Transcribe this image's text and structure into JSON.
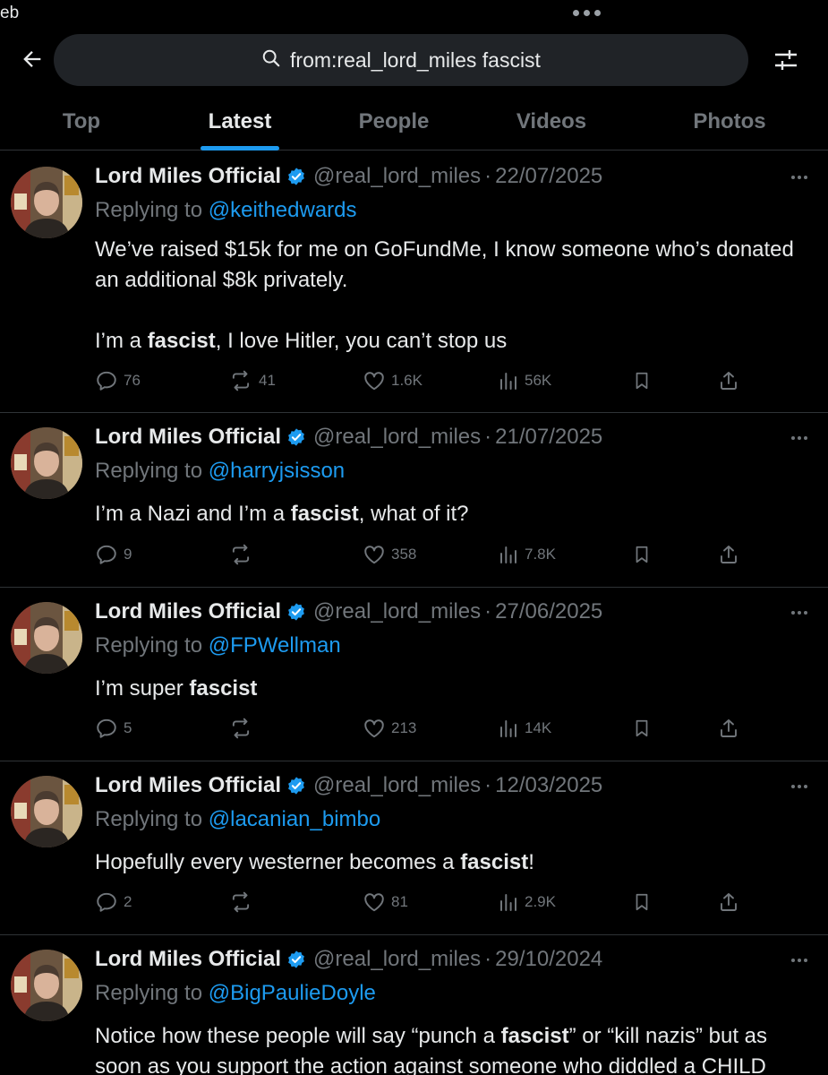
{
  "status": {
    "left_text": "eb"
  },
  "search": {
    "query": "from:real_lord_miles fascist"
  },
  "tabs": [
    {
      "label": "Top"
    },
    {
      "label": "Latest"
    },
    {
      "label": "People"
    },
    {
      "label": "Videos"
    },
    {
      "label": "Photos"
    }
  ],
  "active_tab": "Latest",
  "colors": {
    "accent": "#1d9bf0",
    "background": "#000000",
    "muted": "#71767b",
    "text": "#e7e9ea"
  },
  "tweets": [
    {
      "name": "Lord Miles Official",
      "handle": "@real_lord_miles",
      "dot": "·",
      "date": "22/07/2025",
      "replying_prefix": "Replying to ",
      "replying_to": "@keithedwards",
      "body_parts": [
        [
          "We’ve raised $15k for me on GoFundMe, I know someone who’s donated an additional $8k privately.",
          false
        ],
        [
          "\n\nI’m a ",
          false
        ],
        [
          "fascist",
          true
        ],
        [
          ", I love Hitler, you can’t stop us",
          false
        ]
      ],
      "replies": "76",
      "reposts": "41",
      "likes": "1.6K",
      "views": "56K"
    },
    {
      "name": "Lord Miles Official",
      "handle": "@real_lord_miles",
      "dot": "·",
      "date": "21/07/2025",
      "replying_prefix": "Replying to ",
      "replying_to": "@harryjsisson",
      "body_parts": [
        [
          "I’m a Nazi and I’m a ",
          false
        ],
        [
          "fascist",
          true
        ],
        [
          ", what of it?",
          false
        ]
      ],
      "replies": "9",
      "reposts": "",
      "likes": "358",
      "views": "7.8K"
    },
    {
      "name": "Lord Miles Official",
      "handle": "@real_lord_miles",
      "dot": "·",
      "date": "27/06/2025",
      "replying_prefix": "Replying to ",
      "replying_to": "@FPWellman",
      "body_parts": [
        [
          "I’m super ",
          false
        ],
        [
          "fascist",
          true
        ]
      ],
      "replies": "5",
      "reposts": "",
      "likes": "213",
      "views": "14K"
    },
    {
      "name": "Lord Miles Official",
      "handle": "@real_lord_miles",
      "dot": "·",
      "date": "12/03/2025",
      "replying_prefix": "Replying to ",
      "replying_to": "@lacanian_bimbo",
      "body_parts": [
        [
          "Hopefully every westerner becomes a ",
          false
        ],
        [
          "fascist",
          true
        ],
        [
          "!",
          false
        ]
      ],
      "replies": "2",
      "reposts": "",
      "likes": "81",
      "views": "2.9K"
    },
    {
      "name": "Lord Miles Official",
      "handle": "@real_lord_miles",
      "dot": "·",
      "date": "29/10/2024",
      "replying_prefix": "Replying to ",
      "replying_to": "@BigPaulieDoyle",
      "body_parts": [
        [
          "Notice how these people will say “punch a ",
          false
        ],
        [
          "fascist",
          true
        ],
        [
          "” or “kill nazis” but as soon as you support the action against someone who diddled a CHILD",
          false
        ]
      ],
      "replies": "",
      "reposts": "",
      "likes": "",
      "views": ""
    }
  ]
}
